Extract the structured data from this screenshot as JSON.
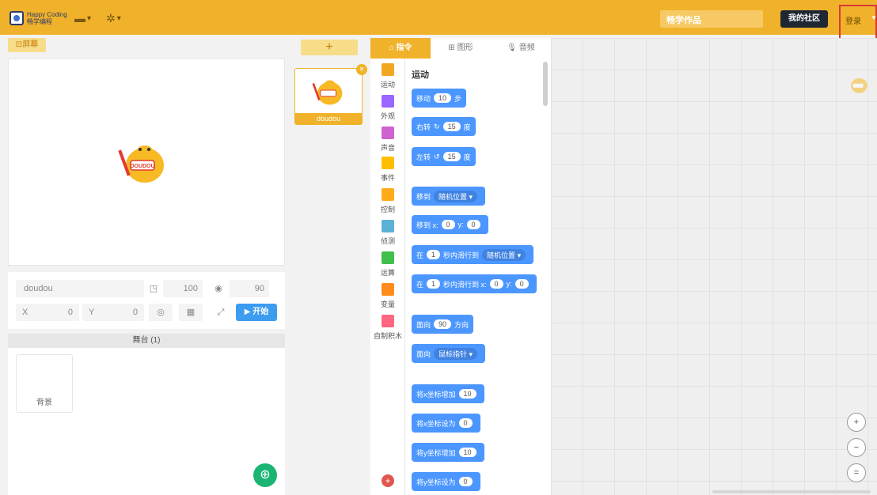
{
  "header": {
    "logo_line1": "Happy Coding",
    "logo_line2": "畅学编程",
    "file_menu_icon": "folder-icon",
    "settings_menu_icon": "gear-icon",
    "works_title": "畅学作品",
    "community_label": "我的社区",
    "login_label": "登录"
  },
  "stage": {
    "screen_label": "屏幕",
    "sprite_name": "doudou",
    "size": "100",
    "direction": "90",
    "x_label": "X",
    "x_value": "0",
    "y_label": "Y",
    "y_value": "0",
    "start_label": "开始",
    "panel_title": "舞台",
    "panel_count": "(1)",
    "backdrop_label": "背景"
  },
  "sprites": {
    "add_label": "+",
    "items": [
      {
        "name": "doudou"
      }
    ]
  },
  "tabs": [
    {
      "label": "指令",
      "icon": "home-icon"
    },
    {
      "label": "图形",
      "icon": "grid-icon"
    },
    {
      "label": "音频",
      "icon": "mic-icon"
    }
  ],
  "categories": [
    {
      "label": "运动",
      "color": "#f0a91f"
    },
    {
      "label": "外观",
      "color": "#9966ff"
    },
    {
      "label": "声音",
      "color": "#cf63cf"
    },
    {
      "label": "事件",
      "color": "#ffbf00"
    },
    {
      "label": "控制",
      "color": "#ffab19"
    },
    {
      "label": "侦测",
      "color": "#5cb1d6"
    },
    {
      "label": "运算",
      "color": "#40bf4a"
    },
    {
      "label": "变量",
      "color": "#ff8c1a"
    },
    {
      "label": "自制积木",
      "color": "#ff6680"
    }
  ],
  "blocks": {
    "section_title": "运动",
    "move": {
      "a": "移动",
      "v": "10",
      "b": "步"
    },
    "turn_right": {
      "a": "右转",
      "v": "15",
      "b": "度"
    },
    "turn_left": {
      "a": "左转",
      "v": "15",
      "b": "度"
    },
    "goto": {
      "a": "移到",
      "dd": "随机位置"
    },
    "goto_xy": {
      "a": "移到 x:",
      "x": "0",
      "yl": "y:",
      "y": "0"
    },
    "glide": {
      "a": "在",
      "v": "1",
      "b": "秒内滑行到",
      "dd": "随机位置"
    },
    "glide_xy": {
      "a": "在",
      "v": "1",
      "b": "秒内滑行到 x:",
      "x": "0",
      "yl": "y:",
      "y": "0"
    },
    "point_dir": {
      "a": "面向",
      "v": "90",
      "b": "方向"
    },
    "point_towards": {
      "a": "面向",
      "dd": "鼠标指针"
    },
    "change_x": {
      "a": "将x坐标增加",
      "v": "10"
    },
    "set_x": {
      "a": "将x坐标设为",
      "v": "0"
    },
    "change_y": {
      "a": "将y坐标增加",
      "v": "10"
    },
    "set_y": {
      "a": "将y坐标设为",
      "v": "0"
    }
  },
  "workspace": {
    "zoom_in": "+",
    "zoom_out": "−",
    "zoom_reset": "="
  }
}
